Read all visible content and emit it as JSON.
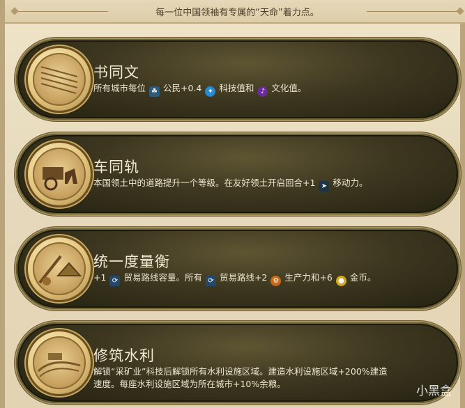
{
  "header": {
    "text": "每一位中国领袖有专属的“天命”着力点。"
  },
  "cards": [
    {
      "title": "书同文",
      "desc_parts": [
        "所有城市每位",
        "公民+0.4",
        "科技值和",
        "文化值。"
      ]
    },
    {
      "title": "车同轨",
      "desc_parts": [
        "本国领土中的道路提升一个等级。在友好领土开启回合+1",
        "移动力。"
      ]
    },
    {
      "title": "统一度量衡",
      "desc_parts": [
        "+1",
        "贸易路线容量。所有",
        "贸易路线+2",
        "生产力和+6",
        "金币。"
      ]
    },
    {
      "title": "修筑水利",
      "desc_line1": "解锁“采矿业”科技后解锁所有水利设施区域。建造水利设施区域+200%建造",
      "desc_line2": "速度。每座水利设施区域为所在城市+10%余粮。"
    }
  ],
  "icons": {
    "citizen": "citizen-icon",
    "science": "science-icon",
    "culture": "culture-icon",
    "movement": "movement-icon",
    "trade_route": "trade-route-icon",
    "production": "production-icon",
    "gold": "gold-icon"
  },
  "watermark": "小黑盒",
  "colors": {
    "card_bg": "#3d3720",
    "parchment": "#e8dcc0",
    "title_text": "#f3ead2"
  }
}
